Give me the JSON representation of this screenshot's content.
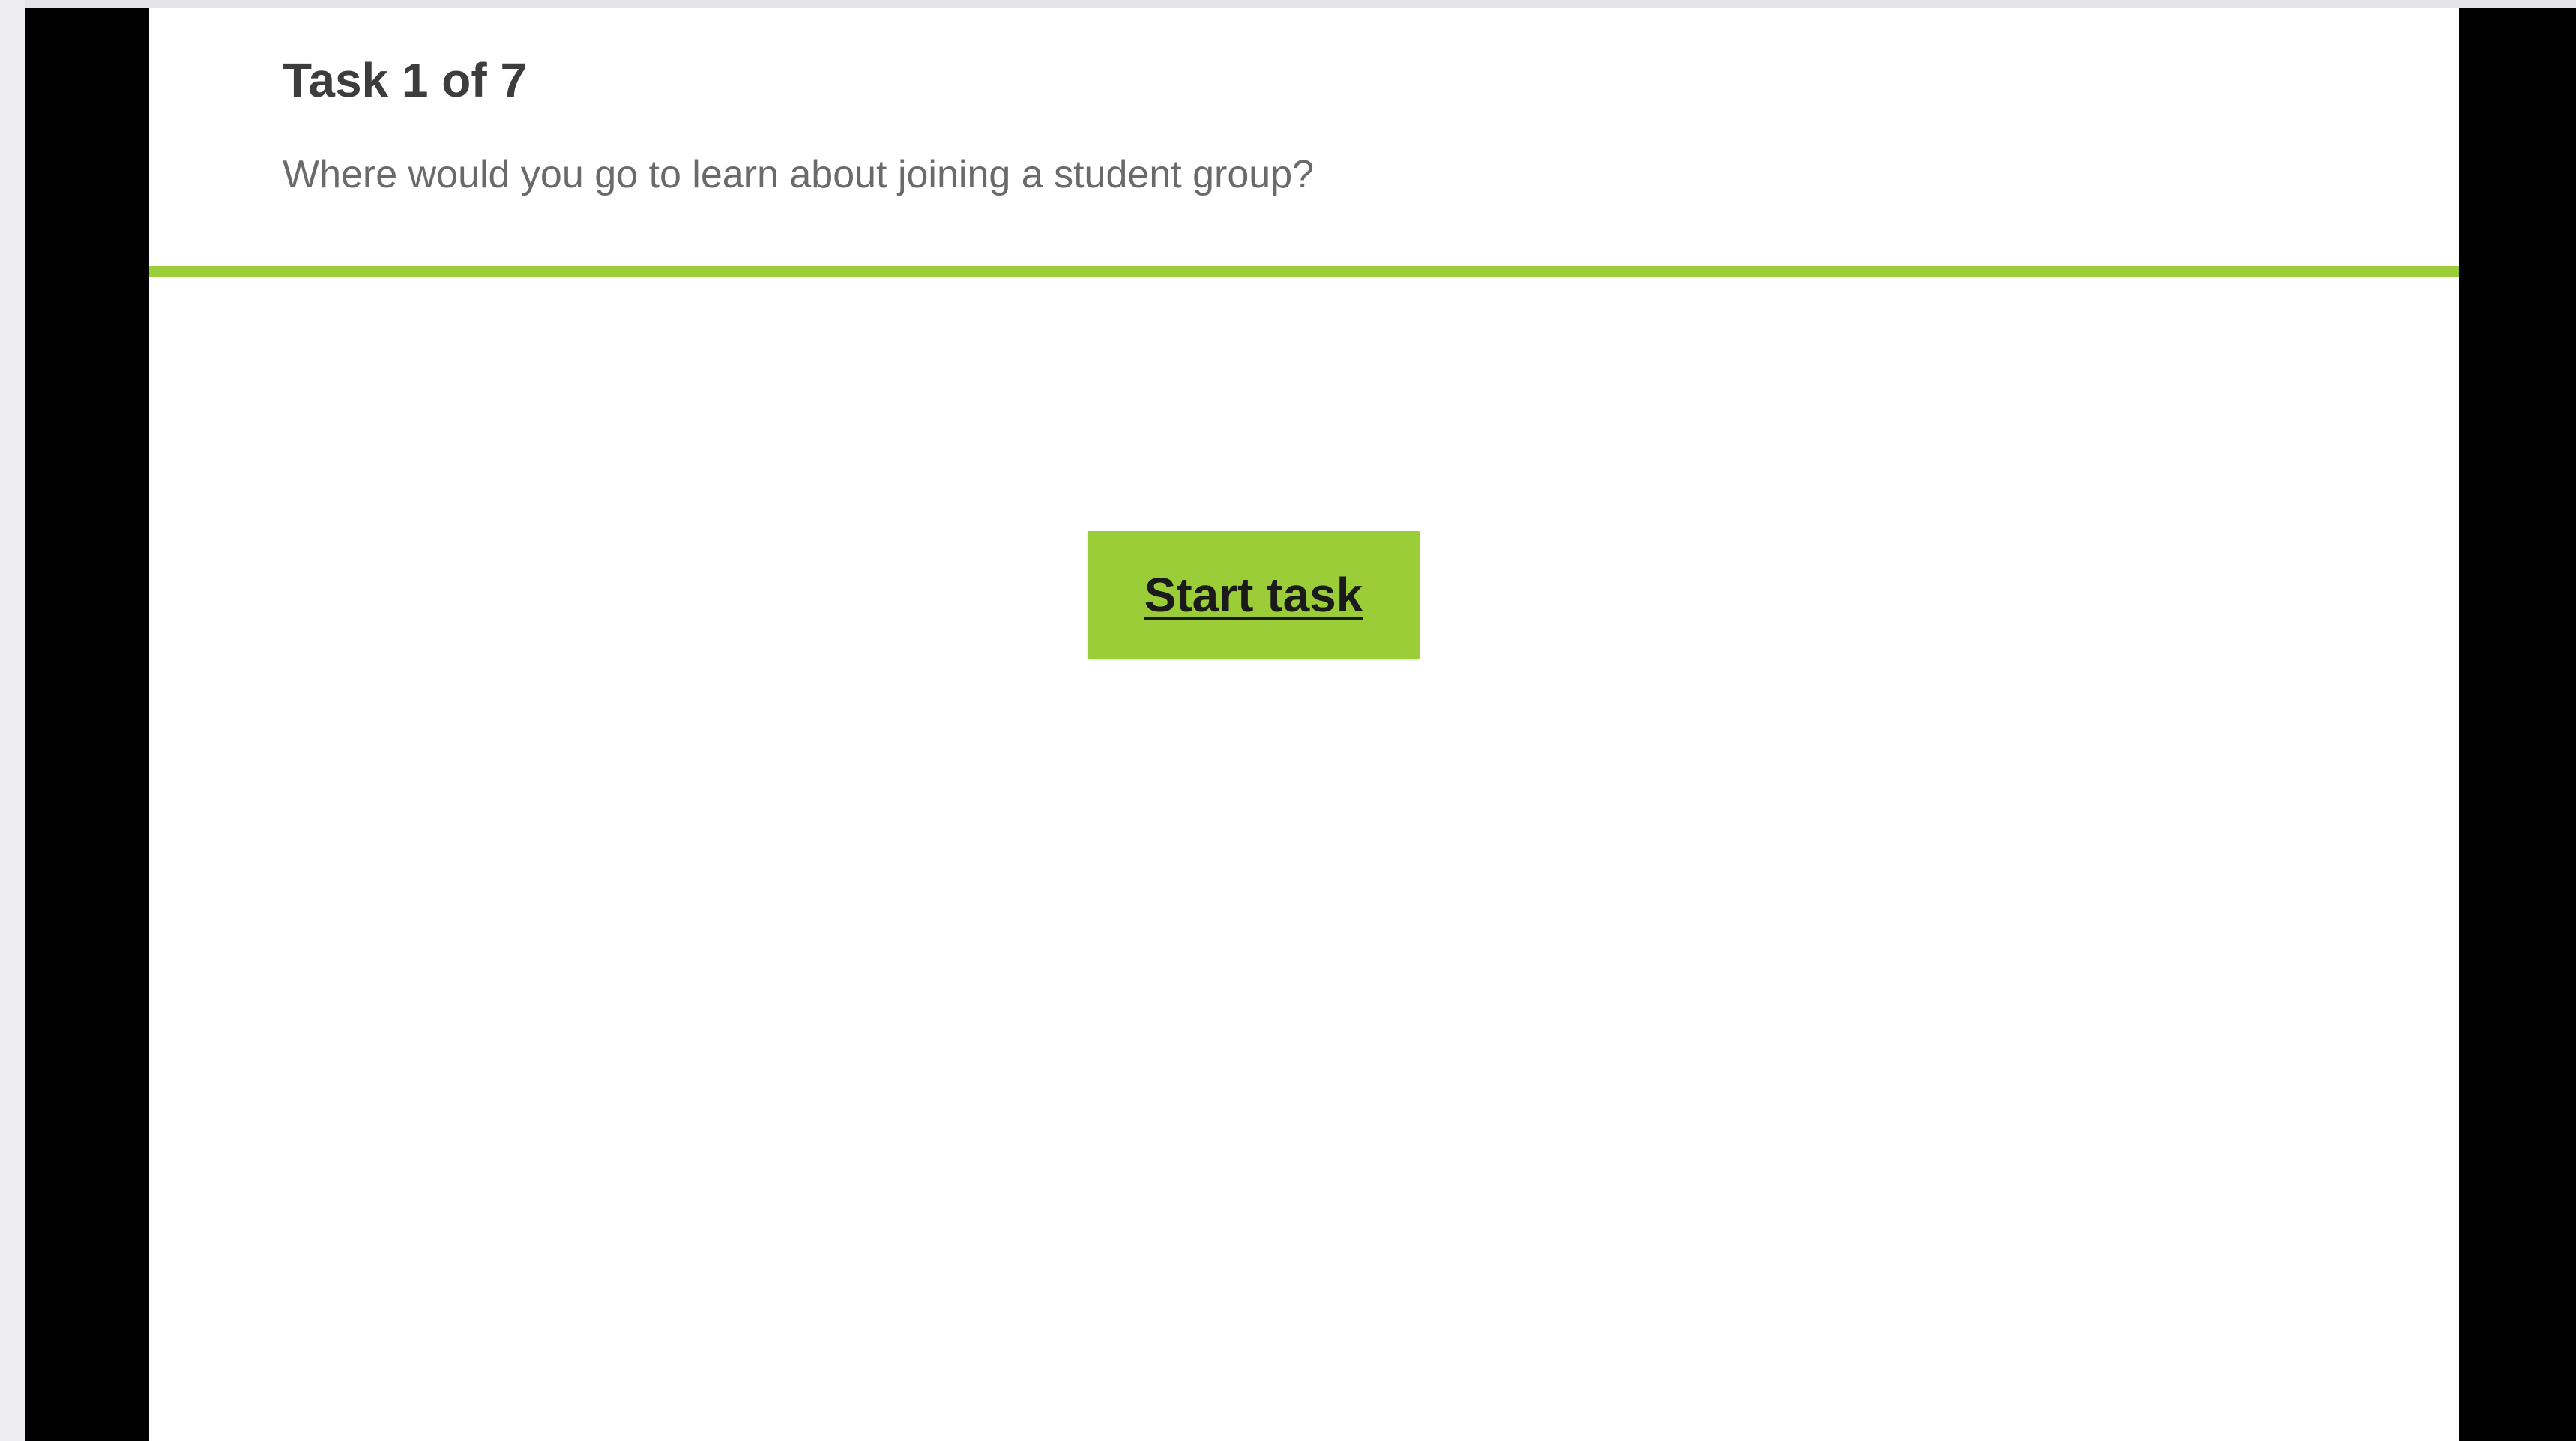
{
  "task": {
    "title": "Task 1 of 7",
    "question": "Where would you go to learn about joining a student group?"
  },
  "start_button": {
    "label": "Start task"
  },
  "colors": {
    "accent": "#9acd38",
    "title_text": "#3d3d3d",
    "question_text": "#6a6a6a",
    "frame": "#000000",
    "background": "#ffffff"
  }
}
